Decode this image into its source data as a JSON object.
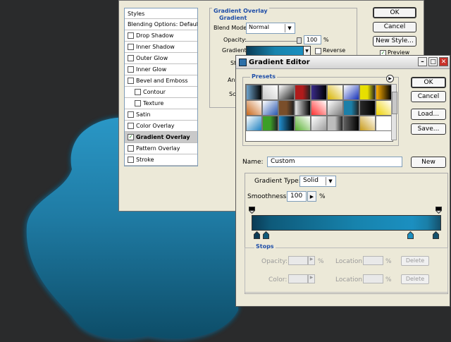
{
  "layer_style": {
    "styles_header": "Styles",
    "blending_options": "Blending Options: Default",
    "items": [
      {
        "label": "Drop Shadow",
        "checked": false,
        "sub": false
      },
      {
        "label": "Inner Shadow",
        "checked": false,
        "sub": false
      },
      {
        "label": "Outer Glow",
        "checked": false,
        "sub": false
      },
      {
        "label": "Inner Glow",
        "checked": false,
        "sub": false
      },
      {
        "label": "Bevel and Emboss",
        "checked": false,
        "sub": false
      },
      {
        "label": "Contour",
        "checked": false,
        "sub": true
      },
      {
        "label": "Texture",
        "checked": false,
        "sub": true
      },
      {
        "label": "Satin",
        "checked": false,
        "sub": false
      },
      {
        "label": "Color Overlay",
        "checked": false,
        "sub": false
      },
      {
        "label": "Gradient Overlay",
        "checked": true,
        "sub": false,
        "selected": true
      },
      {
        "label": "Pattern Overlay",
        "checked": false,
        "sub": false
      },
      {
        "label": "Stroke",
        "checked": false,
        "sub": false
      }
    ],
    "group_title": "Gradient Overlay",
    "sub_group_title": "Gradient",
    "blend_mode_label": "Blend Mode:",
    "blend_mode_value": "Normal",
    "opacity_label": "Opacity:",
    "opacity_value": "100",
    "percent": "%",
    "gradient_label": "Gradient:",
    "reverse_label": "Reverse",
    "style_label_partial": "St",
    "angle_label_partial": "An",
    "scale_label_partial": "Sc",
    "ok_label": "OK",
    "cancel_label": "Cancel",
    "new_style_label": "New Style...",
    "preview_label": "Preview"
  },
  "gradient_editor": {
    "title": "Gradient Editor",
    "presets_label": "Presets",
    "ok_label": "OK",
    "cancel_label": "Cancel",
    "load_label": "Load...",
    "save_label": "Save...",
    "name_label": "Name:",
    "name_value": "Custom",
    "new_label": "New",
    "gradient_type_label": "Gradient Type:",
    "gradient_type_value": "Solid",
    "smoothness_label": "Smoothness:",
    "smoothness_value": "100",
    "percent": "%",
    "stops_label": "Stops",
    "opacity_label": "Opacity:",
    "color_label": "Color:",
    "location_label": "Location:",
    "delete_label": "Delete",
    "swatch_colors": [
      "#6fa4cc",
      "#c9c9c9",
      "#222222",
      "#b01b1b",
      "#3a2b8a",
      "#d8b400",
      "#1531b8",
      "#e7df00",
      "#ffb000",
      "#c8671a",
      "#2857b0",
      "#7a4e2a",
      "#e8e8e8",
      "#ff3030",
      "#7d7d7d",
      "#1b7fa8",
      "#2a2a2a",
      "#efd200",
      "#1d80c0",
      "#3c9f28",
      "#228fd0",
      "#58b030",
      "#9d9d9d",
      "#bdbdbd",
      "#5f5f5f",
      "#c89b1a",
      "#ffffff"
    ],
    "colors": {
      "grad_dark": "#0b3b55",
      "grad_mid": "#1783ad",
      "grad_light": "#1b8fc0"
    }
  }
}
